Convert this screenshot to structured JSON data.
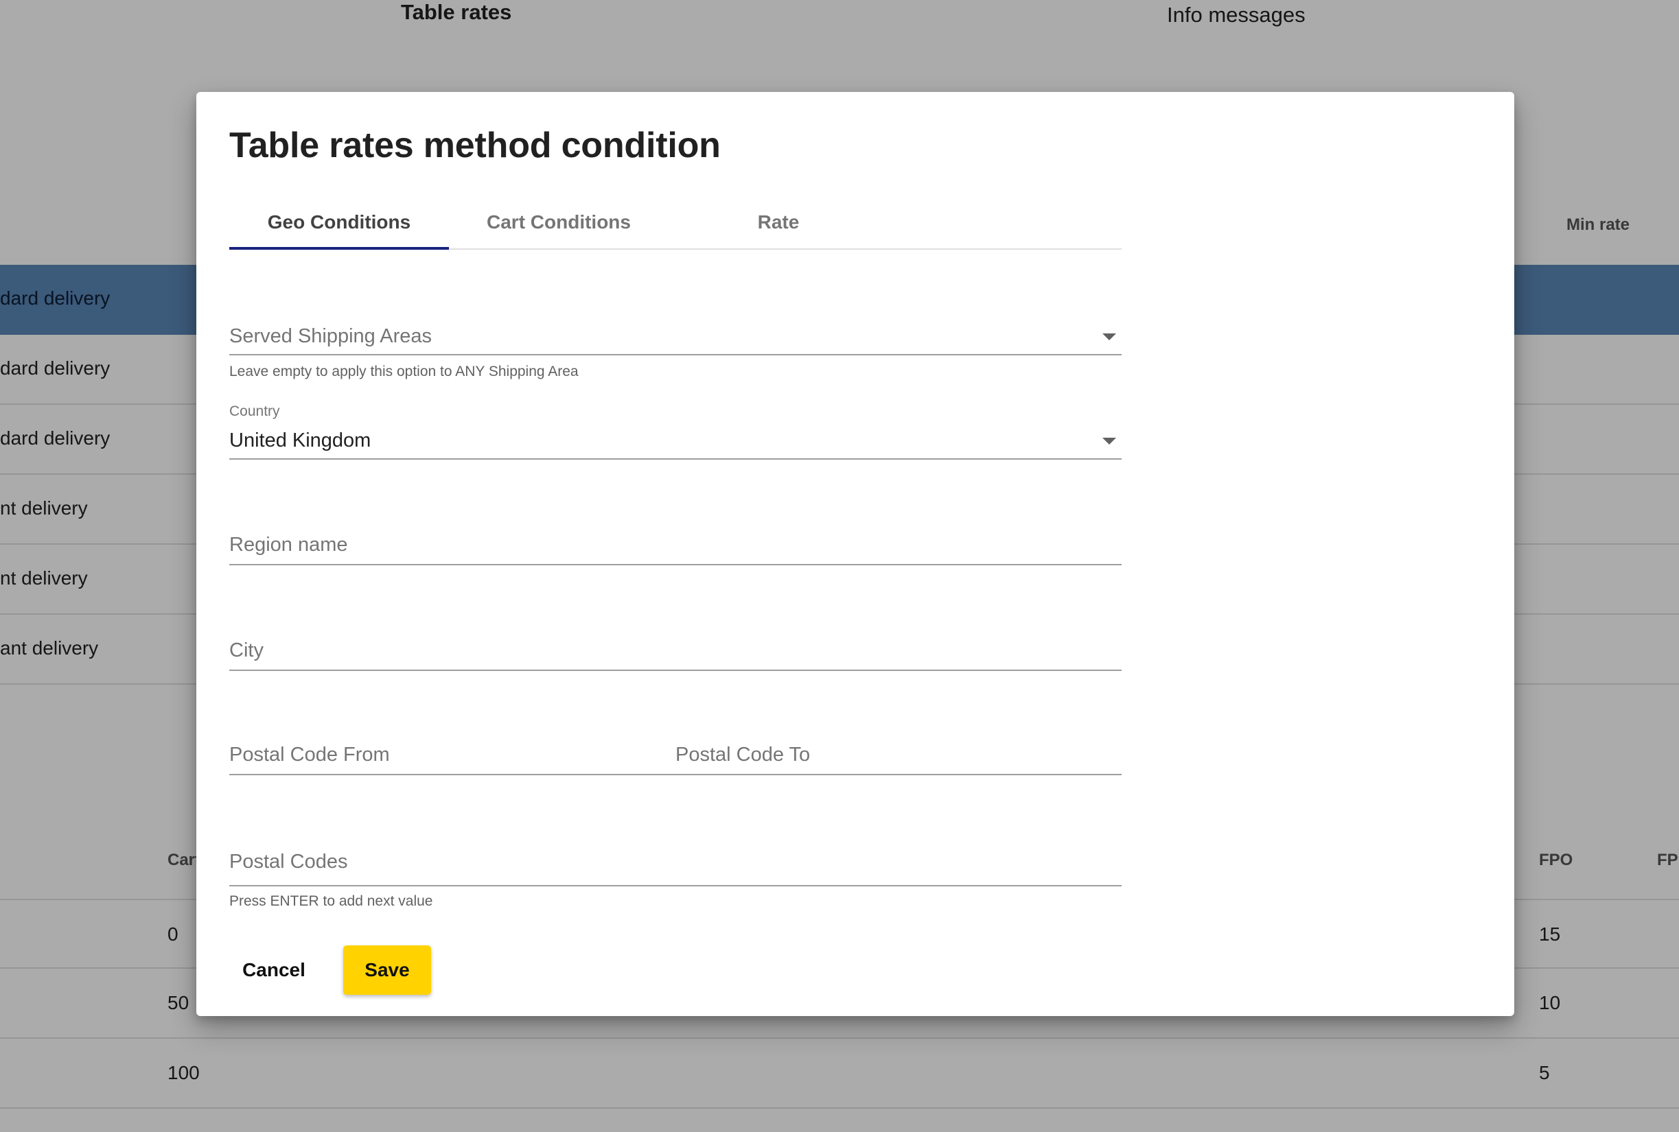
{
  "background": {
    "top_tabs": [
      "Table rates",
      "Info messages"
    ],
    "column_headers": {
      "min_rate": "Min rate",
      "cart": "Cart",
      "fpo": "FPO",
      "fpo2": "FP"
    },
    "method_rows": [
      "dard delivery",
      "dard delivery",
      "dard delivery",
      "nt delivery",
      "nt delivery",
      "ant delivery"
    ],
    "rate_rows": [
      {
        "cart": "0",
        "fpo": "15"
      },
      {
        "cart": "50",
        "fpo": "10"
      },
      {
        "cart": "100",
        "fpo": "5"
      }
    ]
  },
  "dialog": {
    "title": "Table rates method condition",
    "tabs": [
      {
        "label": "Geo Conditions",
        "active": true
      },
      {
        "label": "Cart Conditions",
        "active": false
      },
      {
        "label": "Rate",
        "active": false
      }
    ],
    "fields": {
      "served_shipping_areas": {
        "placeholder": "Served Shipping Areas",
        "hint": "Leave empty to apply this option to ANY Shipping Area"
      },
      "country": {
        "label": "Country",
        "value": "United Kingdom"
      },
      "region_name": {
        "placeholder": "Region name"
      },
      "city": {
        "placeholder": "City"
      },
      "postal_code_from": {
        "placeholder": "Postal Code From"
      },
      "postal_code_to": {
        "placeholder": "Postal Code To"
      },
      "postal_codes": {
        "placeholder": "Postal Codes",
        "hint": "Press ENTER to add next value"
      }
    },
    "buttons": {
      "cancel": "Cancel",
      "save": "Save"
    }
  },
  "colors": {
    "accent_save": "#ffd200",
    "tab_ink": "#1a237e",
    "selected_row": "#5a86b7"
  }
}
